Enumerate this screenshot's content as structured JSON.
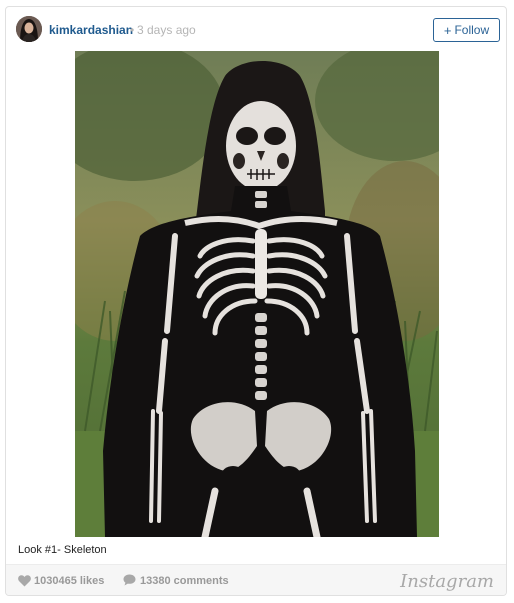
{
  "post": {
    "username": "kimkardashian",
    "separator": "•",
    "time_ago": "3 days ago",
    "follow_plus": "+",
    "follow_label": "Follow",
    "caption": "Look #1- Skeleton",
    "likes": "1030465 likes",
    "comments": "13380 comments",
    "brand": "Instagram"
  },
  "colors": {
    "username": "#1f5a8e",
    "follow_border": "#2b6396",
    "muted": "#999999"
  },
  "icons": {
    "like": "heart-icon",
    "comment": "comment-bubble-icon"
  }
}
